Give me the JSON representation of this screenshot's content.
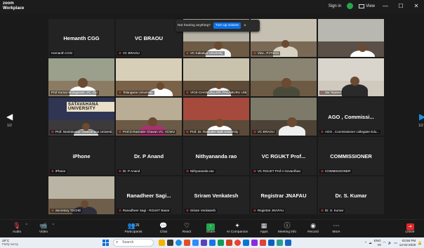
{
  "window": {
    "brand_line1": "zoom",
    "brand_line2": "Workplace",
    "sign_in": "Sign in",
    "view_label": "View",
    "minimize": "—",
    "maximize": "☐",
    "close": "✕"
  },
  "notice": {
    "text": "Not hearing anything?",
    "button": "Turn up volume",
    "close": "×"
  },
  "pagination": {
    "left_arrow": "◀",
    "right_arrow": "▶",
    "left_page": "1/2",
    "right_page": "1/2"
  },
  "tiles": [
    {
      "name": "Hemanth CGG",
      "label": "Hemanth CGG",
      "muted": false,
      "video": false
    },
    {
      "name": "VC BRAOU",
      "label": "VC BRAOU",
      "muted": true,
      "video": false
    },
    {
      "name": "",
      "label": "VC Kakatiya University",
      "muted": true,
      "video": true,
      "scene": "kakatiya"
    },
    {
      "name": "",
      "label": "Vice...PJTSAU",
      "muted": true,
      "video": true,
      "scene": "pjtsau"
    },
    {
      "name": "",
      "label": "",
      "muted": false,
      "video": true,
      "scene": "officegrey"
    },
    {
      "name": "",
      "label": "Prof Kumar Molugaram, VC, OU",
      "muted": false,
      "video": true,
      "scene": "ou",
      "active": true
    },
    {
      "name": "",
      "label": "Telangana University",
      "muted": true,
      "video": true,
      "scene": "tu"
    },
    {
      "name": "",
      "label": "VICE-CHANCELLOR, PALAMURU UNI",
      "muted": true,
      "video": true,
      "scene": "palamuru"
    },
    {
      "name": "",
      "label": "",
      "muted": false,
      "video": true,
      "scene": "officeman"
    },
    {
      "name": "",
      "label": "Sai Tejaswi",
      "muted": true,
      "video": true,
      "scene": "youngman"
    },
    {
      "name": "",
      "label": "Prof. Neelakantan Satavahana University",
      "muted": true,
      "video": true,
      "scene": "satavahana",
      "plaque": "SATAVAHANA UNIVERSITY"
    },
    {
      "name": "",
      "label": "Prof.D.Ravinder Chavan VC, VCWU",
      "muted": true,
      "video": true,
      "scene": "woman"
    },
    {
      "name": "",
      "label": "Prof. Dr. Ravinder Naik University",
      "muted": true,
      "video": true,
      "scene": "redwall"
    },
    {
      "name": "",
      "label": "VC BRAOU",
      "muted": true,
      "video": true,
      "scene": "braou"
    },
    {
      "name": "AGO , Commissi...",
      "label": "AGO , Commissioner collegiate Edu...",
      "muted": true,
      "video": false
    },
    {
      "name": "iPhone",
      "label": "iPhone",
      "muted": true,
      "video": false
    },
    {
      "name": "Dr. P Anand",
      "label": "Dr. P Anand",
      "muted": true,
      "video": false
    },
    {
      "name": "Nithyananda rao",
      "label": "Nithyananda rao",
      "muted": true,
      "video": false
    },
    {
      "name": "VC RGUKT Prof...",
      "label": "VC RGUKT Prof A Govardhan",
      "muted": true,
      "video": false
    },
    {
      "name": "COMMISSIONER",
      "label": "COMMISSIONER",
      "muted": true,
      "video": false
    },
    {
      "name": "",
      "label": "Secretary TSCHE",
      "muted": true,
      "video": true,
      "scene": "tsche"
    },
    {
      "name": "Ranadheer Sagi...",
      "label": "Ranadheer Sagi - RGUKT Basar",
      "muted": true,
      "video": false
    },
    {
      "name": "Sriram Venkatesh",
      "label": "Sriram Venkatesh",
      "muted": true,
      "video": false
    },
    {
      "name": "Registrar JNAFAU",
      "label": "Registrar JNAFAU",
      "muted": true,
      "video": false
    },
    {
      "name": "Dr. S. Kumar",
      "label": "Dr. S. Kumar",
      "muted": true,
      "video": false
    }
  ],
  "toolbar": {
    "audio": "Audio",
    "video": "Video",
    "participants": "Participants",
    "participants_count": "26",
    "chat": "Chat",
    "react": "React",
    "share": "Share",
    "ai_companion": "AI Companion",
    "apps": "Apps",
    "meeting_info": "Meeting info",
    "record": "Record",
    "more": "More",
    "leave": "Leave"
  },
  "taskbar": {
    "temp": "29°C",
    "condition": "Partly sunny",
    "search_placeholder": "Search",
    "lang_line1": "ENG",
    "lang_line2": "IN",
    "time": "03:56 PM",
    "date": "12-02-2025"
  },
  "colors": {
    "active_speaker": "#39d353",
    "muted": "#ff4d4d",
    "zoom_blue": "#0e71eb",
    "share_green": "#22a84b",
    "leave_red": "#e02828"
  }
}
